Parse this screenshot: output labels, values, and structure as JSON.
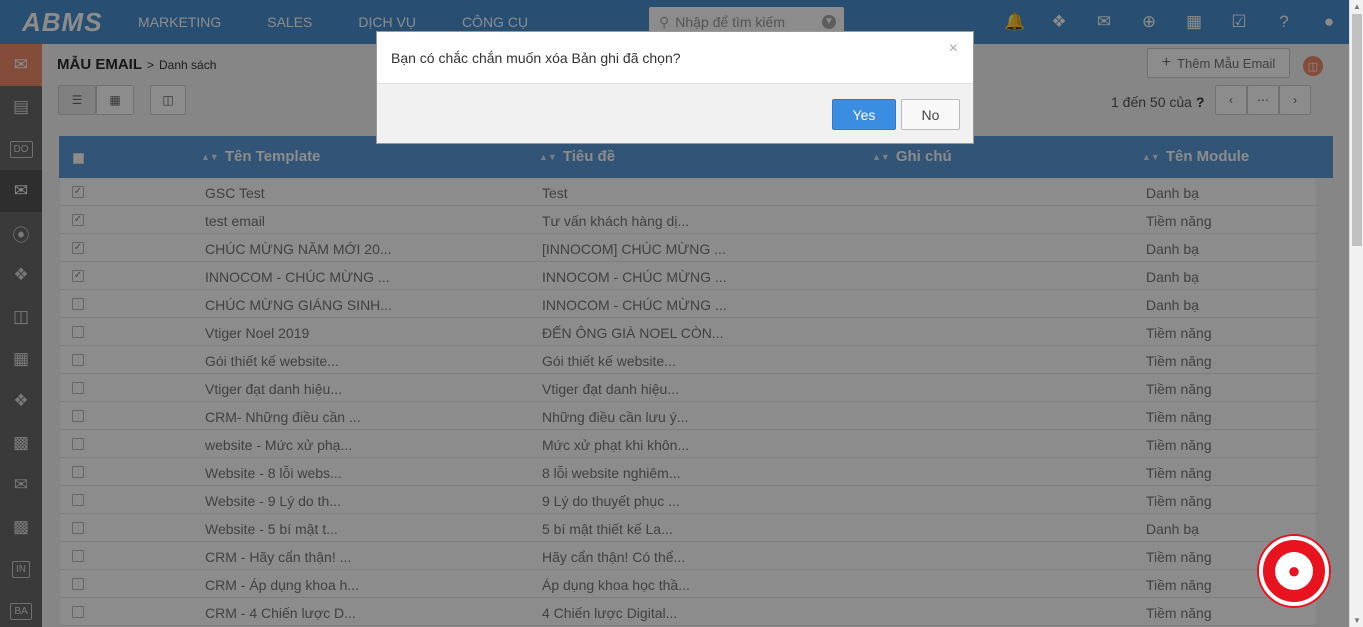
{
  "brand": "ABMS",
  "nav": {
    "items": [
      "MARKETING",
      "SALES",
      "DỊCH VỤ",
      "CÔNG CỤ"
    ],
    "search_placeholder": "Nhập để tìm kiếm",
    "icons": [
      "bell-icon",
      "cubes-icon",
      "chat-icon",
      "plus-circle-icon",
      "calendar-icon",
      "checkbox-icon",
      "help-icon",
      "user-icon"
    ]
  },
  "sidebar": {
    "items": [
      {
        "icon": "email-template-icon",
        "label": ""
      },
      {
        "icon": "document-icon",
        "label": ""
      },
      {
        "icon": "box-icon",
        "label": "DO"
      },
      {
        "icon": "open-envelope-icon",
        "label": ""
      },
      {
        "icon": "rss-icon",
        "label": ""
      },
      {
        "icon": "puzzle-icon",
        "label": ""
      },
      {
        "icon": "trash-icon",
        "label": ""
      },
      {
        "icon": "books-icon",
        "label": ""
      },
      {
        "icon": "puzzle-icon",
        "label": ""
      },
      {
        "icon": "bar-chart-icon",
        "label": ""
      },
      {
        "icon": "mail-gear-icon",
        "label": ""
      },
      {
        "icon": "report-icon",
        "label": ""
      },
      {
        "icon": "box-icon",
        "label": "IN"
      },
      {
        "icon": "box-icon",
        "label": "BA"
      }
    ]
  },
  "page": {
    "title": "MẪU EMAIL",
    "separator": ">",
    "subtitle": "Danh sách",
    "add_button": "Thêm Mẫu Email",
    "pager": "1 đến 50  của",
    "pager_q": "?"
  },
  "table": {
    "columns": [
      "Tên Template",
      "Tiêu đề",
      "Ghi chú",
      "Tên Module"
    ],
    "rows": [
      {
        "checked": true,
        "name": "GSC Test",
        "subject": "Test",
        "note": "",
        "module": "Danh bạ"
      },
      {
        "checked": true,
        "name": "test email",
        "subject": "Tư vấn khách hàng dị...",
        "note": "",
        "module": "Tiềm năng"
      },
      {
        "checked": true,
        "name": "CHÚC MỪNG NĂM MỚI 20...",
        "subject": "[INNOCOM] CHÚC MỪNG ...",
        "note": "",
        "module": "Danh bạ"
      },
      {
        "checked": true,
        "name": "INNOCOM - CHÚC MỪNG ...",
        "subject": "INNOCOM - CHÚC MỪNG ...",
        "note": "",
        "module": "Danh bạ"
      },
      {
        "checked": false,
        "name": "CHÚC MỪNG GIÁNG SINH...",
        "subject": "INNOCOM - CHÚC MỪNG ...",
        "note": "",
        "module": "Danh bạ"
      },
      {
        "checked": false,
        "name": "Vtiger Noel 2019",
        "subject": "ĐẾN ÔNG GIÀ NOEL CÒN...",
        "note": "",
        "module": "Tiềm năng"
      },
      {
        "checked": false,
        "name": "Gói thiết kế website...",
        "subject": "Gói thiết kế website...",
        "note": "",
        "module": "Tiềm năng"
      },
      {
        "checked": false,
        "name": "Vtiger đạt danh hiệu...",
        "subject": "Vtiger đạt danh hiệu...",
        "note": "",
        "module": "Tiềm năng"
      },
      {
        "checked": false,
        "name": "CRM- Những điều cần ...",
        "subject": "Những điều cần lưu ý...",
        "note": "",
        "module": "Tiềm năng"
      },
      {
        "checked": false,
        "name": "website - Mức xử phạ...",
        "subject": "Mức xử phạt khi khôn...",
        "note": "",
        "module": "Tiềm năng"
      },
      {
        "checked": false,
        "name": "Website - 8 lỗi webs...",
        "subject": "8 lỗi website nghiêm...",
        "note": "",
        "module": "Tiềm năng"
      },
      {
        "checked": false,
        "name": "Website - 9 Lý do th...",
        "subject": "9 Lý do thuyết phục ...",
        "note": "",
        "module": "Tiềm năng"
      },
      {
        "checked": false,
        "name": "Website - 5 bí mật t...",
        "subject": "5 bí mật thiết kế La...",
        "note": "",
        "module": "Danh bạ"
      },
      {
        "checked": false,
        "name": "CRM - Hãy cẩn thận! ...",
        "subject": "Hãy cẩn thận! Có thể...",
        "note": "",
        "module": "Tiềm năng"
      },
      {
        "checked": false,
        "name": "CRM - Áp dụng khoa h...",
        "subject": "Áp dụng khoa học thầ...",
        "note": "",
        "module": "Tiềm năng"
      },
      {
        "checked": false,
        "name": "CRM - 4 Chiến lược D...",
        "subject": "4 Chiến lược Digital...",
        "note": "",
        "module": "Tiềm năng"
      }
    ]
  },
  "modal": {
    "message": "Bạn có chắc chắn muốn xóa Bản ghi đã chọn?",
    "close": "×",
    "yes": "Yes",
    "no": "No"
  },
  "colors": {
    "nav": "#4a8ecf",
    "table_header": "#5b9ad8",
    "accent": "#f08c6c",
    "primary_button": "#3a8de0",
    "chat": "#e8131f"
  }
}
